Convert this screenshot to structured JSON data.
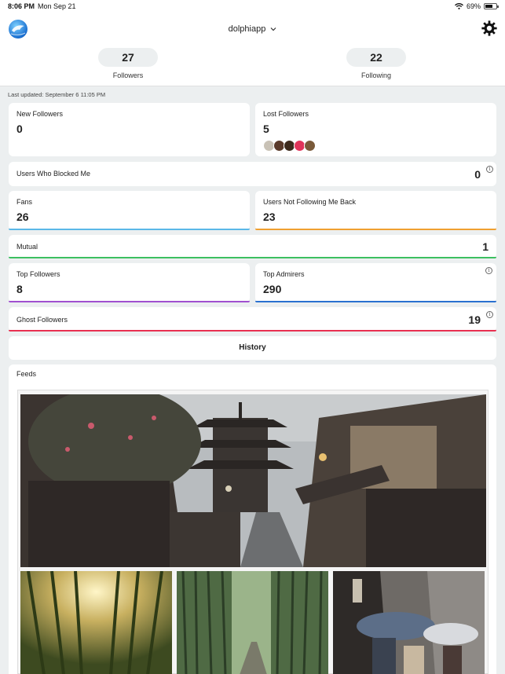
{
  "status_bar": {
    "time": "8:06 PM",
    "date": "Mon Sep 21",
    "battery": "69%",
    "battery_level": 0.69
  },
  "header": {
    "account": "dolphiapp",
    "followers": {
      "count": "27",
      "label": "Followers"
    },
    "following": {
      "count": "22",
      "label": "Following"
    }
  },
  "last_updated": "Last updated: September 6 11:05 PM",
  "cards": {
    "new_followers": {
      "title": "New Followers",
      "value": "0"
    },
    "lost_followers": {
      "title": "Lost Followers",
      "value": "5",
      "avatar_colors": [
        "#c9c2b6",
        "#5a3a2a",
        "#3d2a1c",
        "#e0345a",
        "#7a5a3a"
      ]
    },
    "blocked": {
      "title": "Users Who Blocked Me",
      "value": "0"
    },
    "fans": {
      "title": "Fans",
      "value": "26",
      "color": "#5bb8e8"
    },
    "not_following_back": {
      "title": "Users Not Following Me Back",
      "value": "23",
      "color": "#f0a030"
    },
    "mutual": {
      "title": "Mutual",
      "value": "1",
      "color": "#3cc060"
    },
    "top_followers": {
      "title": "Top Followers",
      "value": "8",
      "color": "#a050d0"
    },
    "top_admirers": {
      "title": "Top Admirers",
      "value": "290",
      "color": "#2a70d0"
    },
    "ghost_followers": {
      "title": "Ghost Followers",
      "value": "19",
      "color": "#e83050"
    }
  },
  "history": {
    "label": "History"
  },
  "feeds": {
    "title": "Feeds",
    "photos": [
      "kyoto-pagoda-street",
      "bamboo-forest-sunlight",
      "bamboo-path",
      "umbrella-street"
    ]
  },
  "icons": {
    "logo": "dolphin-logo-icon",
    "settings": "gear-icon",
    "dropdown": "chevron-down-icon",
    "info": "info-icon"
  }
}
